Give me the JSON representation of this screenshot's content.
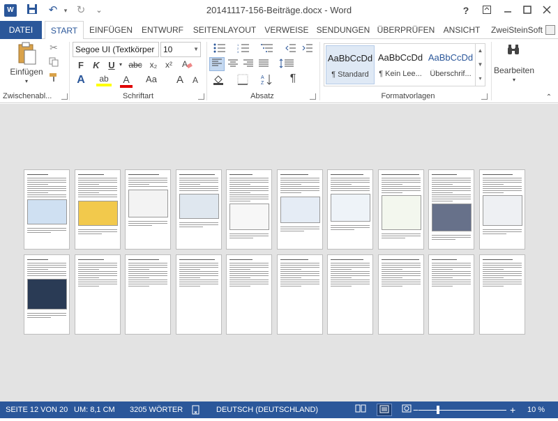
{
  "window": {
    "title": "20141117-156-Beiträge.docx - Word",
    "help": "?",
    "account": "ZweiSteinSoft"
  },
  "qat": {
    "word_logo": "W",
    "save_icon": "💾",
    "undo_icon": "↶",
    "redo_icon": "↻",
    "customize_icon": "⌄"
  },
  "tabs": [
    {
      "label": "DATEI"
    },
    {
      "label": "START"
    },
    {
      "label": "EINFÜGEN"
    },
    {
      "label": "ENTWURF"
    },
    {
      "label": "SEITENLAYOUT"
    },
    {
      "label": "VERWEISE"
    },
    {
      "label": "SENDUNGEN"
    },
    {
      "label": "ÜBERPRÜFEN"
    },
    {
      "label": "ANSICHT"
    }
  ],
  "ribbon": {
    "clipboard": {
      "paste_label": "Einfügen",
      "group_label": "Zwischenabl..."
    },
    "font": {
      "font_name": "Segoe UI (Textkörper",
      "font_size": "10",
      "bold": "F",
      "italic": "K",
      "underline": "U",
      "strike": "abc",
      "sub": "x₂",
      "sup": "x²",
      "effects": "A",
      "highlight": "ab",
      "fontcolor": "A",
      "case": "Aa",
      "grow": "A",
      "shrink": "A",
      "group_label": "Schriftart"
    },
    "paragraph": {
      "pilcrow": "¶",
      "group_label": "Absatz"
    },
    "styles": {
      "items": [
        {
          "sample": "AaBbCcDd",
          "name": "¶ Standard"
        },
        {
          "sample": "AaBbCcDd",
          "name": "¶ Kein Lee..."
        },
        {
          "sample": "AaBbCcDd",
          "name": "Überschrif..."
        }
      ],
      "group_label": "Formatvorlagen"
    },
    "editing": {
      "label": "Bearbeiten"
    }
  },
  "status": {
    "page": "SEITE 12 VON 20",
    "position": "UM: 8,1 CM",
    "words": "3205 WÖRTER",
    "language": "DEUTSCH (DEUTSCHLAND)",
    "zoom_minus": "−",
    "zoom_plus": "+",
    "zoom": "10 %",
    "zoom_percent": 10
  },
  "colors": {
    "accent": "#2b579a",
    "doc_bg": "#e3e3e3"
  }
}
